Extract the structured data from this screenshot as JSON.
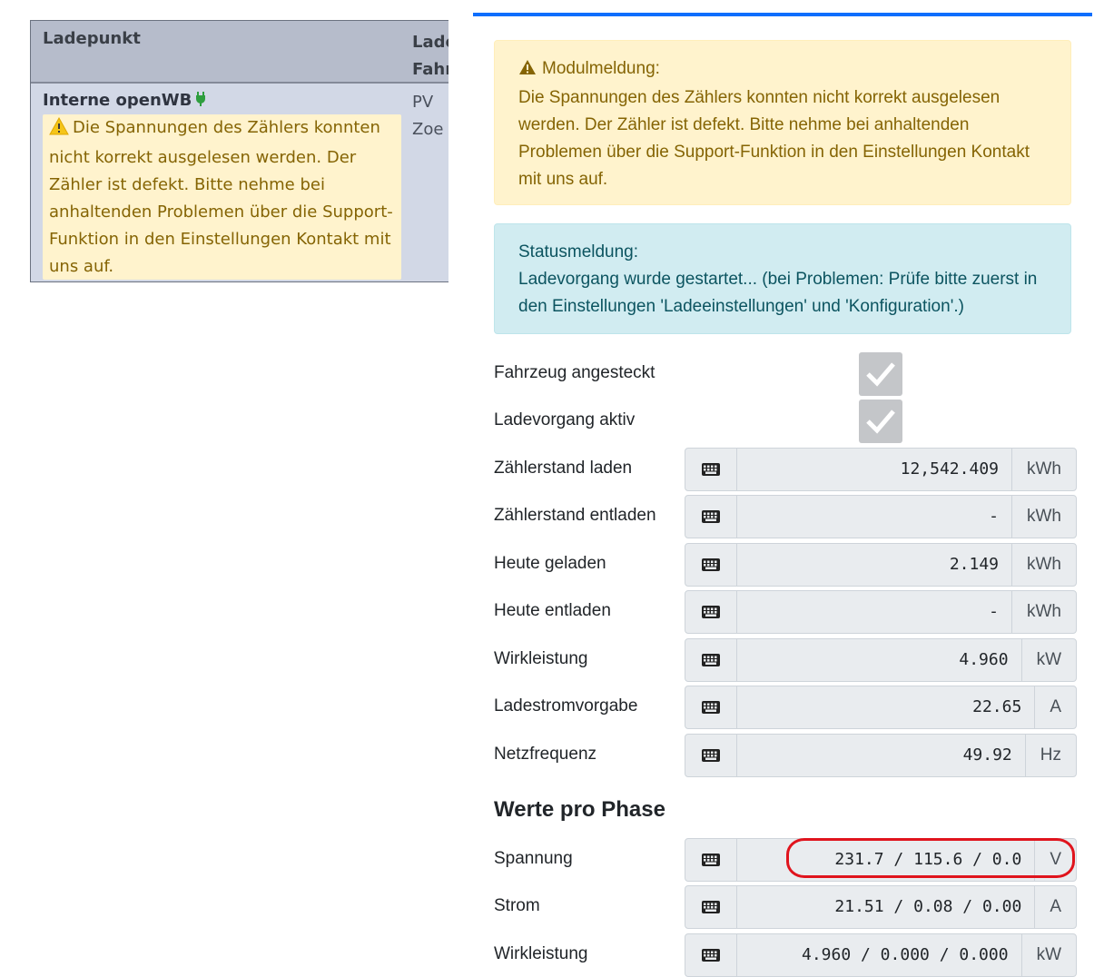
{
  "left_table": {
    "headers": [
      "Ladepunkt",
      "Lade",
      "Fahr"
    ],
    "row": {
      "name": "Interne openWB",
      "warning": "Die Spannungen des Zählers konnten nicht korrekt ausgelesen werden. Der Zähler ist defekt. Bitte nehme bei anhaltenden Problemen über die Support-Funktion in den Einstellungen Kontakt mit uns auf.",
      "col2_line1": "PV",
      "col2_line2": "Zoe"
    }
  },
  "alerts": {
    "module_title": "Modulmeldung:",
    "module_text": "Die Spannungen des Zählers konnten nicht korrekt ausgelesen werden. Der Zähler ist defekt. Bitte nehme bei anhaltenden Problemen über die Support-Funktion in den Einstellungen Kontakt mit uns auf.",
    "status_title": "Statusmeldung:",
    "status_text": "Ladevorgang wurde gestartet... (bei Problemen: Prüfe bitte zuerst in den Einstellungen 'Ladeeinstellungen' und 'Konfiguration'.)"
  },
  "checks": [
    {
      "label": "Fahrzeug angesteckt",
      "checked": true
    },
    {
      "label": "Ladevorgang aktiv",
      "checked": true
    }
  ],
  "values": [
    {
      "label": "Zählerstand laden",
      "value": "12,542.409",
      "unit": "kWh"
    },
    {
      "label": "Zählerstand entladen",
      "value": "-",
      "unit": "kWh"
    },
    {
      "label": "Heute geladen",
      "value": "2.149",
      "unit": "kWh"
    },
    {
      "label": "Heute entladen",
      "value": "-",
      "unit": "kWh"
    },
    {
      "label": "Wirkleistung",
      "value": "4.960",
      "unit": "kW"
    },
    {
      "label": "Ladestromvorgabe",
      "value": "22.65",
      "unit": "A"
    },
    {
      "label": "Netzfrequenz",
      "value": "49.92",
      "unit": "Hz"
    }
  ],
  "phase_title": "Werte pro Phase",
  "phase_values": [
    {
      "label": "Spannung",
      "value": "231.7 / 115.6 / 0.0",
      "unit": "V"
    },
    {
      "label": "Strom",
      "value": "21.51 / 0.08 / 0.00",
      "unit": "A"
    },
    {
      "label": "Wirkleistung",
      "value": "4.960 / 0.000 / 0.000",
      "unit": "kW"
    }
  ],
  "icons": {
    "warning": "warning-triangle-icon",
    "keyboard": "keyboard-icon",
    "check": "check-icon",
    "plug": "plug-icon"
  },
  "colors": {
    "accent": "#0d6efd",
    "highlight": "#e0141d",
    "warning_text": "#856404",
    "info_text": "#0c5460"
  }
}
